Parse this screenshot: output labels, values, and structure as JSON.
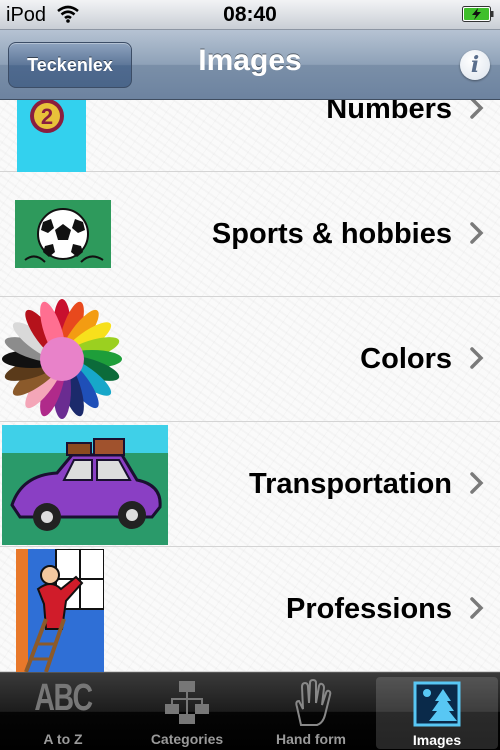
{
  "status_bar": {
    "carrier": "iPod",
    "time": "08:40",
    "wifi_icon": "wifi-icon",
    "battery_icon": "battery-charging-icon"
  },
  "nav": {
    "back_label": "Teckenlex",
    "title": "Images",
    "info_icon": "info-icon",
    "info_glyph": "i"
  },
  "list": {
    "items": [
      {
        "label": "Numbers",
        "icon": "number-two-badge-image"
      },
      {
        "label": "Sports & hobbies",
        "icon": "soccer-ball-image"
      },
      {
        "label": "Colors",
        "icon": "color-wheel-image"
      },
      {
        "label": "Transportation",
        "icon": "car-with-luggage-image"
      },
      {
        "label": "Professions",
        "icon": "painter-on-ladder-image"
      }
    ],
    "number_badge_text": "2"
  },
  "tab_bar": {
    "tabs": [
      {
        "label": "A to Z",
        "icon": "abc-icon",
        "icon_text": "ABC",
        "selected": false
      },
      {
        "label": "Categories",
        "icon": "hierarchy-icon",
        "selected": false
      },
      {
        "label": "Hand form",
        "icon": "hand-icon",
        "selected": false
      },
      {
        "label": "Images",
        "icon": "picture-tree-icon",
        "selected": true
      }
    ]
  },
  "colors": {
    "nav_bar": "#7a8fa8",
    "battery_green": "#3fbf2b",
    "tab_selected": "#ffffff",
    "tab_unselected": "#9a9a9a"
  }
}
